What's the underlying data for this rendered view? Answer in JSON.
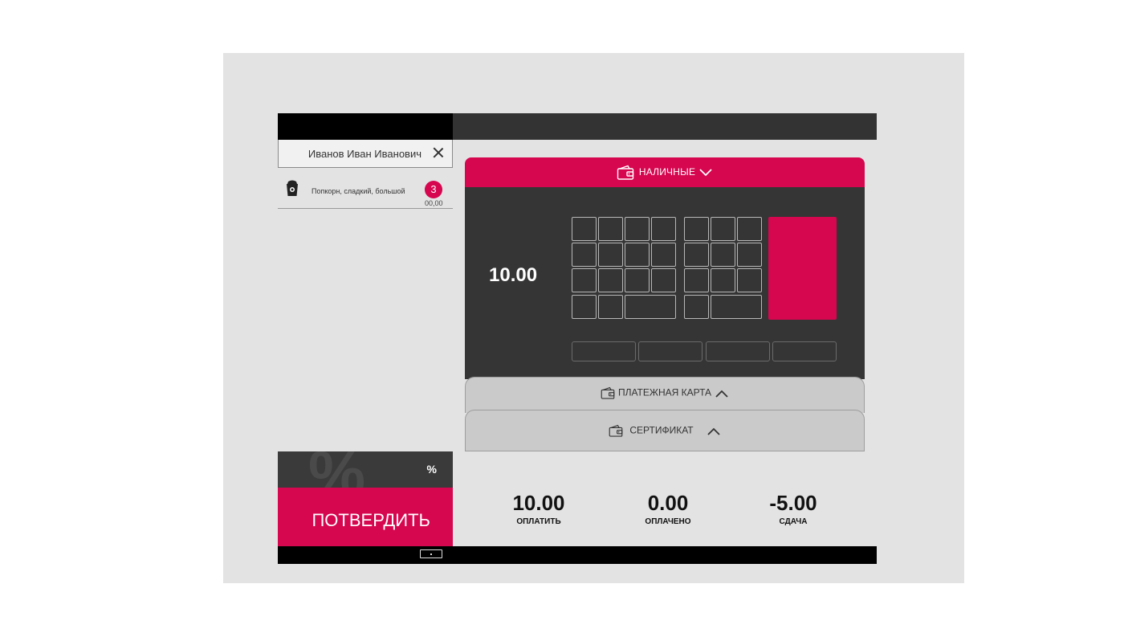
{
  "customer": {
    "name": "Иванов Иван Иванович"
  },
  "order": {
    "items": [
      {
        "label": "Попкорн, сладкий, большой",
        "quantity": "3",
        "price": "00,00",
        "icon": "popcorn-cup-icon"
      }
    ]
  },
  "payment": {
    "active_method": "НАЛИЧНЫЕ",
    "amount": "10.00",
    "methods": [
      {
        "label": "ПЛАТЕЖНАЯ КАРТА",
        "icon": "wallet-icon"
      },
      {
        "label": "СЕРТИФИКАТ",
        "icon": "wallet-icon"
      }
    ]
  },
  "discount": {
    "label": "%"
  },
  "confirm_label": "ПОТВЕРДИТЬ",
  "totals": [
    {
      "value": "10.00",
      "label": "ОПЛАТИТЬ"
    },
    {
      "value": "0.00",
      "label": "ОПЛАЧЕНО"
    },
    {
      "value": "-5.00",
      "label": "СДАЧА"
    }
  ],
  "colors": {
    "accent": "#d6064f",
    "panel": "#353535",
    "background": "#e3e3e3"
  }
}
